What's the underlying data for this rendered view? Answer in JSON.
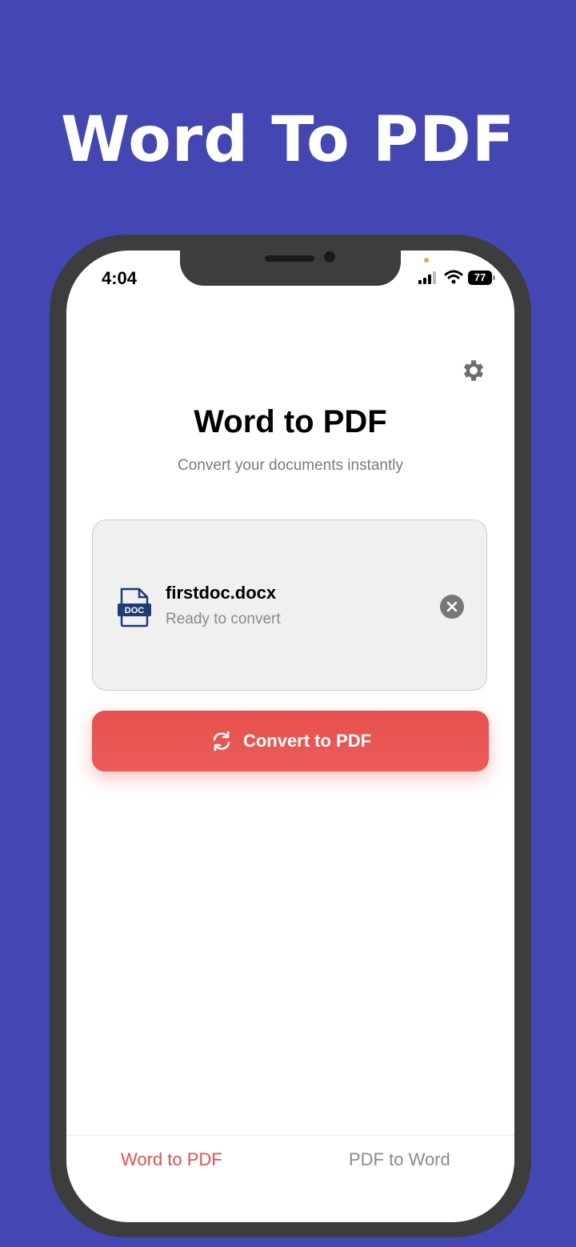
{
  "promo": {
    "title": "Word To PDF"
  },
  "status_bar": {
    "time": "4:04",
    "battery": "77"
  },
  "header": {
    "title": "Word to PDF",
    "subtitle": "Convert your documents instantly",
    "settings_icon": "gear-icon"
  },
  "file": {
    "icon_label": "DOC",
    "name": "firstdoc.docx",
    "status": "Ready to convert"
  },
  "actions": {
    "convert_label": "Convert to PDF"
  },
  "tabs": [
    {
      "label": "Word to PDF",
      "active": true
    },
    {
      "label": "PDF to Word",
      "active": false
    }
  ],
  "colors": {
    "background": "#4447b3",
    "accent": "#e8504d",
    "frame": "#3d3d3d",
    "doc_icon": "#1f3b73"
  }
}
